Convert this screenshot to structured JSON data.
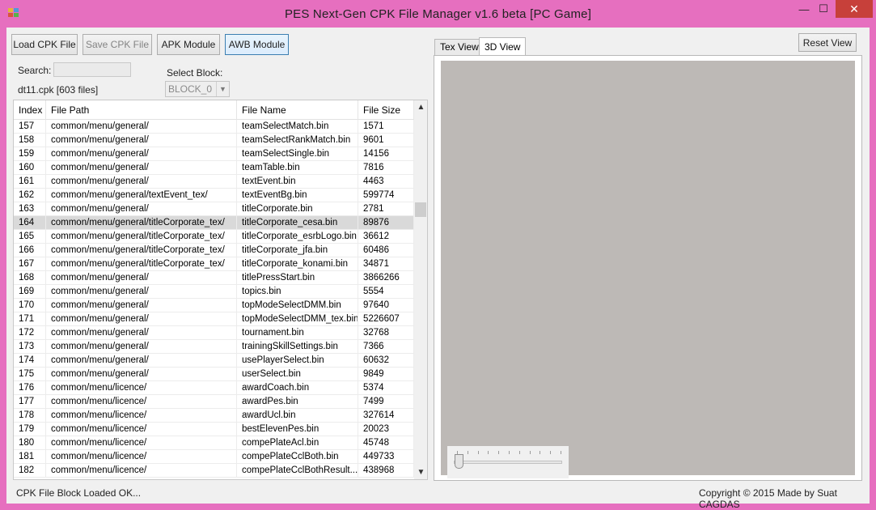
{
  "window": {
    "title": "PES Next-Gen CPK File Manager v1.6 beta [PC Game]",
    "min_glyph": "—",
    "max_glyph": "☐",
    "close_glyph": "✕"
  },
  "toolbar": {
    "load_label": "Load CPK File",
    "save_label": "Save CPK File",
    "apk_label": "APK Module",
    "awb_label": "AWB Module"
  },
  "search": {
    "label": "Search:",
    "value": ""
  },
  "block": {
    "label": "Select Block:",
    "selected": "BLOCK_0"
  },
  "file_info": "dt11.cpk [603 files]",
  "grid": {
    "columns": [
      "Index",
      "File Path",
      "File Name",
      "File Size"
    ],
    "selected_index": 7,
    "rows": [
      [
        "157",
        "common/menu/general/",
        "teamSelectMatch.bin",
        "1571"
      ],
      [
        "158",
        "common/menu/general/",
        "teamSelectRankMatch.bin",
        "9601"
      ],
      [
        "159",
        "common/menu/general/",
        "teamSelectSingle.bin",
        "14156"
      ],
      [
        "160",
        "common/menu/general/",
        "teamTable.bin",
        "7816"
      ],
      [
        "161",
        "common/menu/general/",
        "textEvent.bin",
        "4463"
      ],
      [
        "162",
        "common/menu/general/textEvent_tex/",
        "textEventBg.bin",
        "599774"
      ],
      [
        "163",
        "common/menu/general/",
        "titleCorporate.bin",
        "2781"
      ],
      [
        "164",
        "common/menu/general/titleCorporate_tex/",
        "titleCorporate_cesa.bin",
        "89876"
      ],
      [
        "165",
        "common/menu/general/titleCorporate_tex/",
        "titleCorporate_esrbLogo.bin",
        "36612"
      ],
      [
        "166",
        "common/menu/general/titleCorporate_tex/",
        "titleCorporate_jfa.bin",
        "60486"
      ],
      [
        "167",
        "common/menu/general/titleCorporate_tex/",
        "titleCorporate_konami.bin",
        "34871"
      ],
      [
        "168",
        "common/menu/general/",
        "titlePressStart.bin",
        "3866266"
      ],
      [
        "169",
        "common/menu/general/",
        "topics.bin",
        "5554"
      ],
      [
        "170",
        "common/menu/general/",
        "topModeSelectDMM.bin",
        "97640"
      ],
      [
        "171",
        "common/menu/general/",
        "topModeSelectDMM_tex.bin",
        "5226607"
      ],
      [
        "172",
        "common/menu/general/",
        "tournament.bin",
        "32768"
      ],
      [
        "173",
        "common/menu/general/",
        "trainingSkillSettings.bin",
        "7366"
      ],
      [
        "174",
        "common/menu/general/",
        "usePlayerSelect.bin",
        "60632"
      ],
      [
        "175",
        "common/menu/general/",
        "userSelect.bin",
        "9849"
      ],
      [
        "176",
        "common/menu/licence/",
        "awardCoach.bin",
        "5374"
      ],
      [
        "177",
        "common/menu/licence/",
        "awardPes.bin",
        "7499"
      ],
      [
        "178",
        "common/menu/licence/",
        "awardUcl.bin",
        "327614"
      ],
      [
        "179",
        "common/menu/licence/",
        "bestElevenPes.bin",
        "20023"
      ],
      [
        "180",
        "common/menu/licence/",
        "compePlateAcl.bin",
        "45748"
      ],
      [
        "181",
        "common/menu/licence/",
        "compePlateCclBoth.bin",
        "449733"
      ],
      [
        "182",
        "common/menu/licence/",
        "compePlateCclBothResult....",
        "438968"
      ]
    ],
    "scroll_up_glyph": "▲",
    "scroll_down_glyph": "▼"
  },
  "status": {
    "left": "CPK File Block Loaded OK...",
    "right": "Copyright © 2015 Made by Suat CAGDAS"
  },
  "viewer": {
    "tabs": [
      "Tex View",
      "3D View"
    ],
    "active_tab": 1,
    "reset_label": "Reset View",
    "viewport_color": "#bdb9b6",
    "slider_value": 0
  },
  "colors": {
    "frame": "#e66fbf",
    "close": "#c7403a",
    "selected_row": "#d9d9d9"
  },
  "icons": {
    "app": "app-grid-icon",
    "combo_arrow": "chevron-down-icon"
  }
}
